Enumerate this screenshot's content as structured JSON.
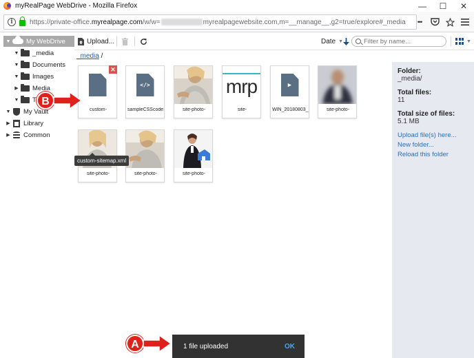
{
  "window": {
    "title": "myRealPage WebDrive - Mozilla Firefox",
    "minimize": "—",
    "maximize": "☐",
    "close": "✕"
  },
  "browser": {
    "url_prefix": "https://private-office.",
    "url_domain": "myrealpage.com",
    "url_middle": "/w/w=",
    "url_suffix": "myrealpagewebsite.com,m=__manage__,g2=true/explore#_media",
    "menu_dots": "•••"
  },
  "sidebar": {
    "items": [
      {
        "label": "My WebDrive",
        "caret": "▼"
      },
      {
        "label": "_media",
        "caret": "▼"
      },
      {
        "label": "Documents",
        "caret": "▼"
      },
      {
        "label": "Images",
        "caret": "▼"
      },
      {
        "label": "Media",
        "caret": "▶"
      },
      {
        "label": "Ty",
        "caret": "▼"
      },
      {
        "label": "My Vault",
        "caret": "▼"
      },
      {
        "label": "Library",
        "caret": "▶"
      },
      {
        "label": "Common",
        "caret": "▶"
      }
    ]
  },
  "toolbar": {
    "upload_label": "Upload...",
    "sort_label": "Date",
    "search_placeholder": "Filter by name..."
  },
  "breadcrumb": {
    "folder": "_media",
    "separator": "/"
  },
  "files": [
    {
      "name": "custom-",
      "kind": "document",
      "glyph": ""
    },
    {
      "name": "sampleCSScode.c",
      "kind": "code",
      "glyph": "</>"
    },
    {
      "name": "site-photo-",
      "kind": "photo"
    },
    {
      "name": "site-",
      "kind": "logo",
      "logo_text": "mrp"
    },
    {
      "name": "WIN_20180803_1",
      "kind": "video",
      "glyph": "▶"
    },
    {
      "name": "site-photo-",
      "kind": "photo-blurred"
    },
    {
      "name": "site-photo-",
      "kind": "photo"
    },
    {
      "name": "site-photo-",
      "kind": "photo"
    },
    {
      "name": "site-photo-",
      "kind": "photo-suit"
    }
  ],
  "tooltip": "custom-sitemap.xml",
  "details": {
    "folder_label": "Folder:",
    "folder_value": "_media/",
    "total_files_label": "Total files:",
    "total_files_value": "11",
    "total_size_label": "Total size of files:",
    "total_size_value": "5.1 MB",
    "links": [
      "Upload file(s) here...",
      "New folder...",
      "Reload this folder"
    ]
  },
  "annotations": {
    "a": "A",
    "b": "B"
  },
  "snackbar": {
    "message": "1 file uploaded",
    "action": "OK"
  },
  "colors": {
    "accent": "#1a5fb4",
    "annotation_red": "#e0201b",
    "details_bg": "#e6e9ef",
    "snackbar_bg": "#323232"
  }
}
